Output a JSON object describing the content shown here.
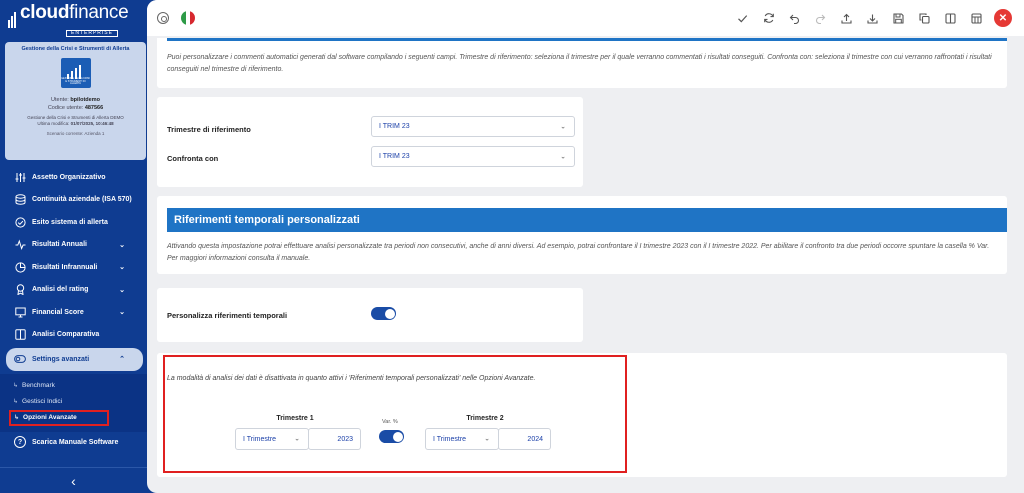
{
  "brand": {
    "name_bold": "cloud",
    "name_light": "finance",
    "edition": "ENTERPRISE"
  },
  "card": {
    "title": "Gestione della Crisi e Strumenti di Allerta",
    "logo_caption": "GESTIONE DELLA CRISI E STRUMENTI DI ALLERTA",
    "user_label": "Utente:",
    "user_value": "bpilotdemo",
    "code_label": "Codice utente:",
    "code_value": "487566",
    "meta_line1": "Gestione della Crisi e Strumenti di Allerta DEMO",
    "meta_line2_label": "Ultima modifica:",
    "meta_line2_value": "01/07/2025, 10:46:48",
    "scenario": "Scenario corrente: Azienda 1"
  },
  "nav": {
    "items": [
      {
        "label": "Assetto Organizzativo",
        "icon": "sliders-icon"
      },
      {
        "label": "Continuità aziendale (ISA 570)",
        "icon": "database-icon"
      },
      {
        "label": "Esito sistema di allerta",
        "icon": "check-circle-icon"
      },
      {
        "label": "Risultati Annuali",
        "icon": "pulse-icon",
        "chevron": "⌄"
      },
      {
        "label": "Risultati Infrannuali",
        "icon": "pie-icon",
        "chevron": "⌄"
      },
      {
        "label": "Analisi del rating",
        "icon": "award-icon",
        "chevron": "⌄"
      },
      {
        "label": "Financial Score",
        "icon": "monitor-icon",
        "chevron": "⌄"
      },
      {
        "label": "Analisi Comparativa",
        "icon": "columns-icon"
      }
    ],
    "active": {
      "label": "Settings avanzati",
      "chevron": "⌃"
    },
    "sub_items": [
      "Benchmark",
      "Gestisci Indici",
      "Opzioni Avanzate"
    ],
    "download": "Scarica Manuale Software",
    "collapse": "‹"
  },
  "intro": {
    "text": "Puoi personalizzare i commenti automatici generati dal software compilando i seguenti campi. Trimestre di riferimento: seleziona il trimestre per il quale verranno commentati i risultati conseguiti. Confronta con: seleziona il trimestre con cui verranno raffrontati i risultati conseguiti nel trimestre di riferimento."
  },
  "quarters": {
    "ref_label": "Trimestre di riferimento",
    "ref_value": "I TRIM 23",
    "compare_label": "Confronta con",
    "compare_value": "I TRIM 23"
  },
  "custom_refs": {
    "title": "Riferimenti temporali personalizzati",
    "text": "Attivando questa impostazione potrai effettuare analisi personalizzate tra periodi non consecutivi, anche di anni diversi. Ad esempio, potrai confrontare il I trimestre 2023 con il I trimestre 2022. Per abilitare il confronto tra due periodi occorre spuntare la casella % Var. Per maggiori informazioni consulta il manuale.",
    "toggle_label": "Personalizza riferimenti temporali",
    "toggle_on": true
  },
  "analysis": {
    "notice": "La modalità di analisi dei dati è disattivata in quanto attivi i 'Riferimenti temporali personalizzati' nelle Opzioni Avanzate.",
    "q1_label": "Trimestre 1",
    "q1_select": "I Trimestre",
    "q1_year": "2023",
    "var_label": "Var. %",
    "var_on": true,
    "q2_label": "Trimestre 2",
    "q2_select": "I Trimestre",
    "q2_year": "2024"
  },
  "colors": {
    "sidebar": "#0f3c91",
    "accent": "#1f74c5",
    "highlight": "#e02020",
    "toggle": "#1a4ca6"
  }
}
